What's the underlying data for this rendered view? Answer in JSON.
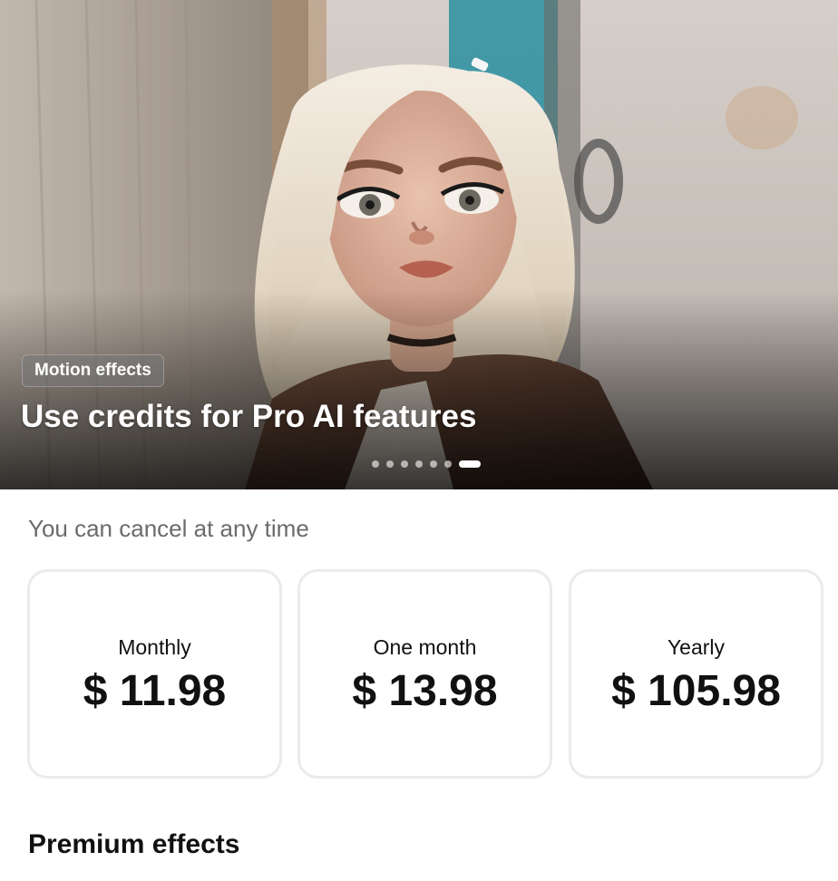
{
  "hero": {
    "tag": "Motion effects",
    "headline": "Use credits for Pro AI features",
    "slides_total": 7,
    "active_slide": 7,
    "image": "stylized-3d-doll-portrait"
  },
  "subscription": {
    "note": "You can cancel at any time",
    "plans": [
      {
        "name": "Monthly",
        "price": "$ 11.98"
      },
      {
        "name": "One month",
        "price": "$ 13.98"
      },
      {
        "name": "Yearly",
        "price": "$ 105.98"
      }
    ]
  },
  "sections": {
    "premium_title": "Premium effects"
  },
  "colors": {
    "text_primary": "#111111",
    "text_secondary": "#6b6b6b",
    "card_border": "#ebebeb"
  }
}
